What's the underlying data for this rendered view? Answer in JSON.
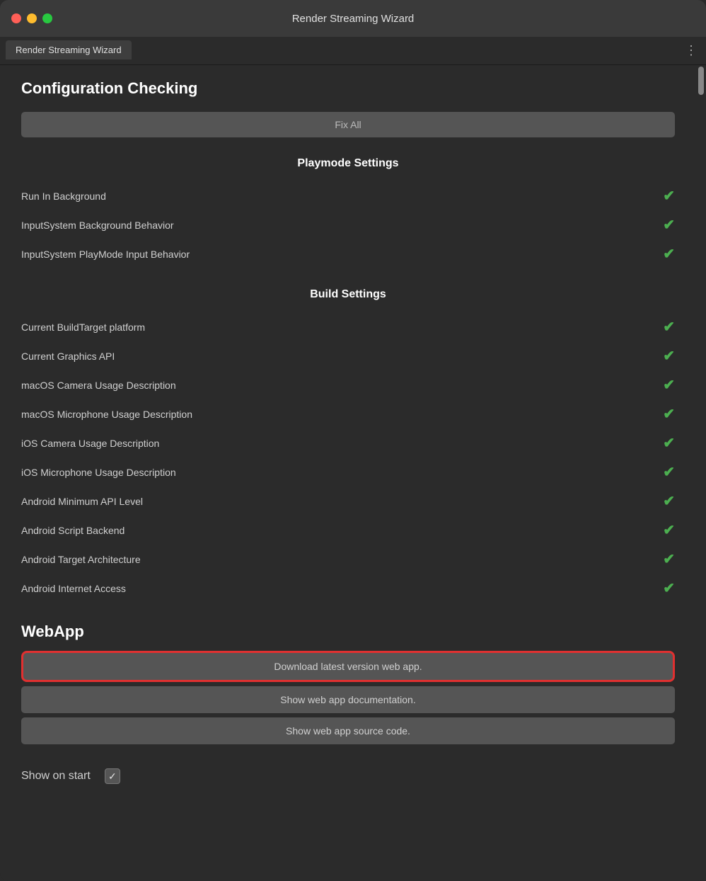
{
  "window": {
    "title": "Render Streaming Wizard"
  },
  "titlebar": {
    "title": "Render Streaming Wizard",
    "traffic_lights": [
      "close",
      "minimize",
      "maximize"
    ]
  },
  "tabbar": {
    "active_tab": "Render Streaming Wizard",
    "more_icon": "⋮"
  },
  "page": {
    "title": "Configuration Checking",
    "fix_all_button": "Fix All"
  },
  "playmode_section": {
    "header": "Playmode Settings",
    "settings": [
      {
        "label": "Run In Background",
        "status": "check"
      },
      {
        "label": "InputSystem Background Behavior",
        "status": "check"
      },
      {
        "label": "InputSystem PlayMode Input Behavior",
        "status": "check"
      }
    ]
  },
  "build_section": {
    "header": "Build Settings",
    "settings": [
      {
        "label": "Current BuildTarget platform",
        "status": "check"
      },
      {
        "label": "Current Graphics API",
        "status": "check"
      },
      {
        "label": "macOS Camera Usage Description",
        "status": "check"
      },
      {
        "label": "macOS Microphone Usage Description",
        "status": "check"
      },
      {
        "label": "iOS Camera Usage Description",
        "status": "check"
      },
      {
        "label": "iOS Microphone Usage Description",
        "status": "check"
      },
      {
        "label": "Android Minimum API Level",
        "status": "check"
      },
      {
        "label": "Android Script Backend",
        "status": "check"
      },
      {
        "label": "Android Target Architecture",
        "status": "check"
      },
      {
        "label": "Android Internet Access",
        "status": "check"
      }
    ]
  },
  "webapp_section": {
    "title": "WebApp",
    "buttons": [
      {
        "label": "Download latest version web app.",
        "highlighted": true
      },
      {
        "label": "Show web app documentation.",
        "highlighted": false
      },
      {
        "label": "Show web app source code.",
        "highlighted": false
      }
    ]
  },
  "footer": {
    "show_on_start_label": "Show on start",
    "show_on_start_checked": true,
    "checkbox_check": "✓"
  },
  "icons": {
    "check_mark": "✔",
    "more_menu": "⋮",
    "scrollbar_up": "▲"
  }
}
